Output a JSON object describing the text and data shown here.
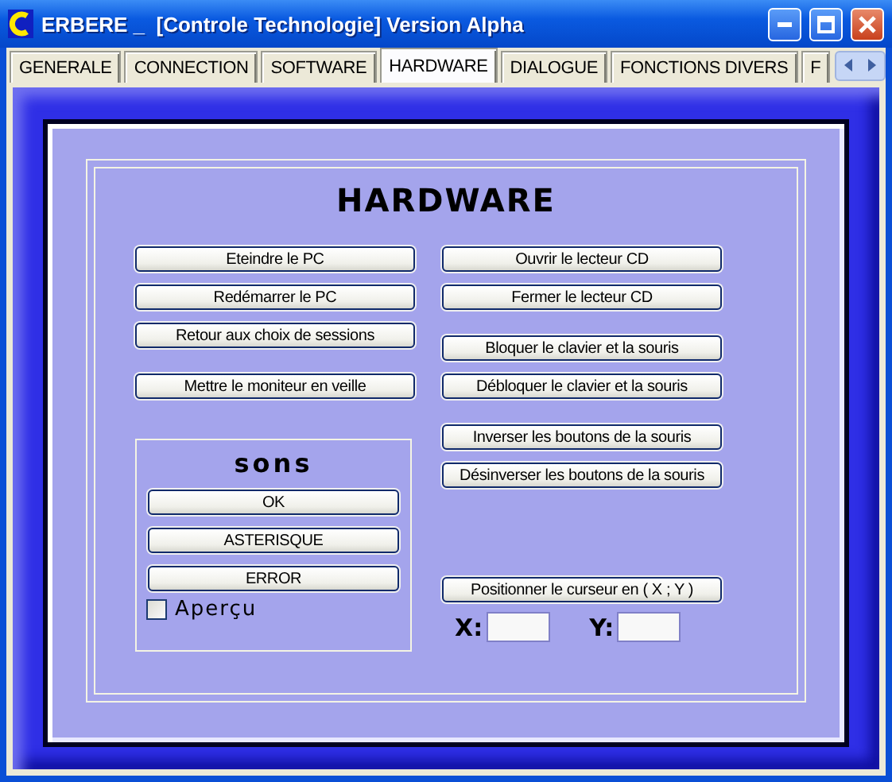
{
  "window": {
    "title": "ERBERE _  [Controle Technologie] Version Alpha"
  },
  "tabs": [
    {
      "label": "GENERALE",
      "selected": false
    },
    {
      "label": "CONNECTION",
      "selected": false
    },
    {
      "label": "SOFTWARE",
      "selected": false
    },
    {
      "label": "HARDWARE",
      "selected": true
    },
    {
      "label": "DIALOGUE",
      "selected": false
    },
    {
      "label": "FONCTIONS DIVERS",
      "selected": false
    },
    {
      "label": "F",
      "selected": false
    }
  ],
  "heading": "HARDWARE",
  "left_button_groups": [
    [
      "Eteindre le PC",
      "Redémarrer le PC",
      "Retour aux choix de sessions"
    ],
    [
      "Mettre le moniteur en veille"
    ]
  ],
  "right_button_groups": [
    [
      "Ouvrir le lecteur CD",
      "Fermer le lecteur CD"
    ],
    [
      "Bloquer le clavier et la souris",
      "Débloquer le clavier et la souris"
    ],
    [
      "Inverser les boutons de la souris",
      "Désinverser les boutons de la souris"
    ]
  ],
  "sounds": {
    "title": "sons",
    "buttons": [
      "OK",
      "ASTERISQUE",
      "ERROR"
    ],
    "preview": {
      "label": "Aperçu",
      "checked": false
    }
  },
  "cursor": {
    "button": "Positionner le curseur en ( X ; Y )",
    "x_label": "X:",
    "y_label": "Y:"
  }
}
